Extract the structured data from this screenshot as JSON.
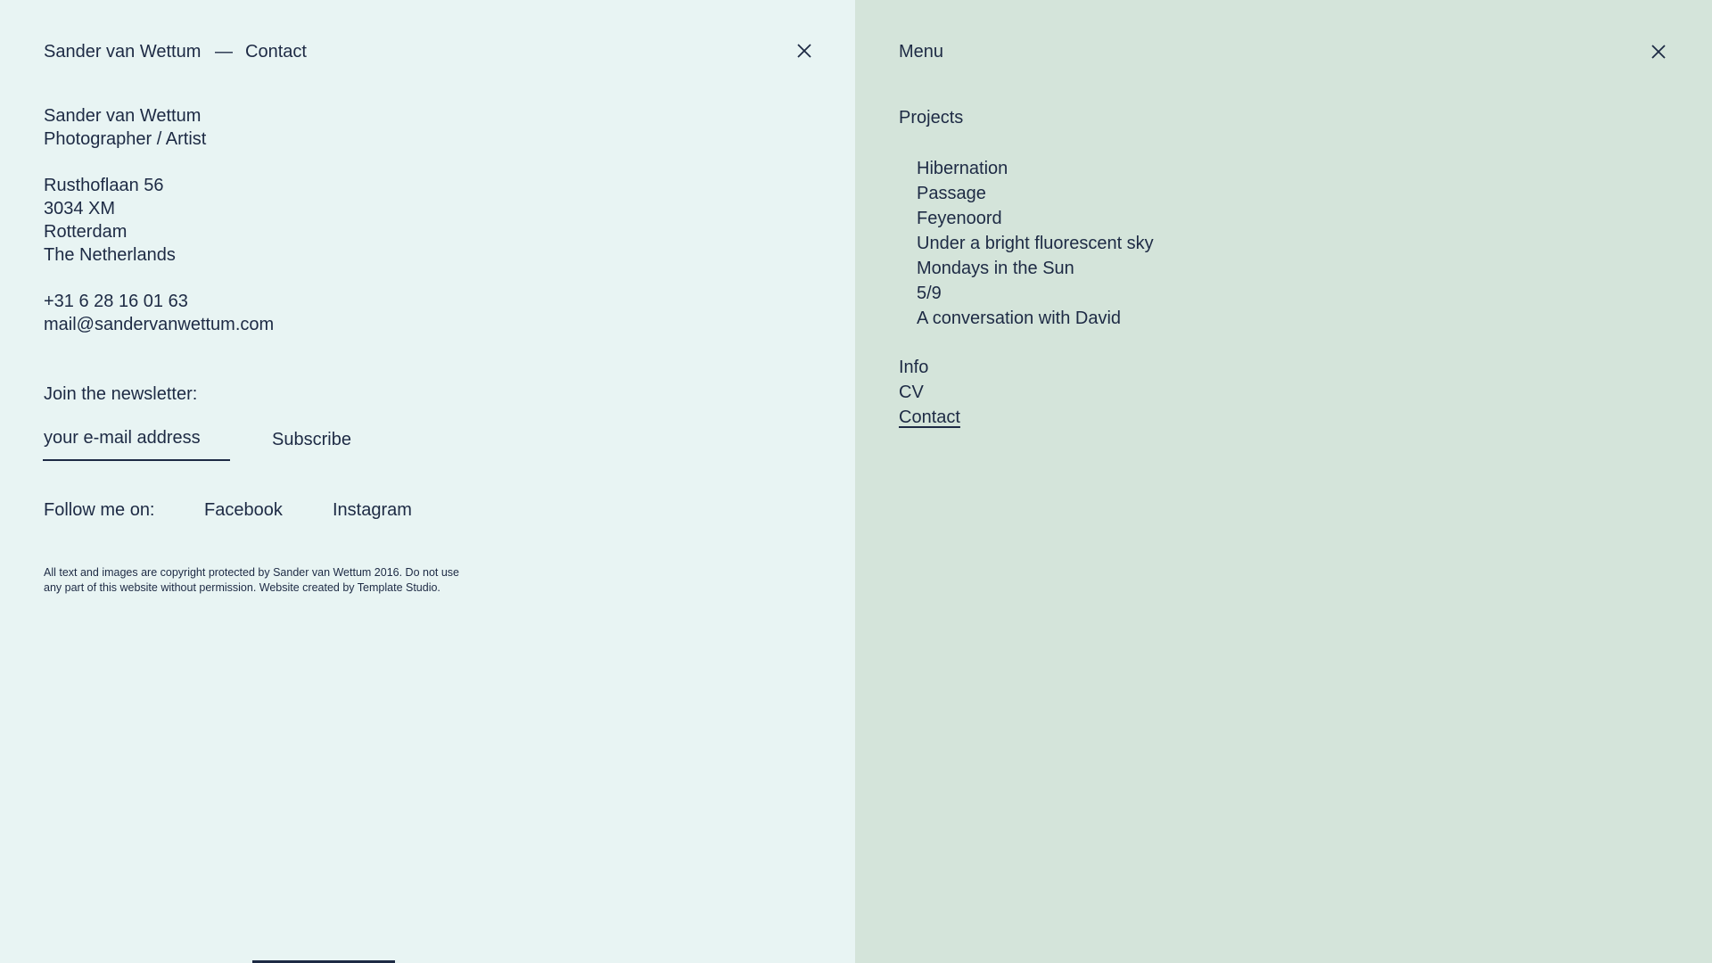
{
  "contact_panel": {
    "header": {
      "site_name": "Sander van Wettum",
      "separator": "—",
      "page_name": "Contact"
    },
    "identity": {
      "name": "Sander van Wettum",
      "role": "Photographer / Artist"
    },
    "address": {
      "street": "Rusthoflaan 56",
      "postcode": "3034 XM",
      "city": "Rotterdam",
      "country": "The Netherlands"
    },
    "contact": {
      "phone": "+31 6 28 16 01 63",
      "email": "mail@sandervanwettum.com"
    },
    "newsletter": {
      "label": "Join the newsletter:",
      "input_placeholder": "your e-mail address",
      "input_value": "",
      "subscribe_label": "Subscribe"
    },
    "social": {
      "label": "Follow me on:",
      "facebook": "Facebook",
      "instagram": "Instagram"
    },
    "copyright": {
      "line1": "All text and images are copyright protected by Sander van Wettum 2016.  Do not use",
      "line2": "any part of this website without permission. Website created by Template Studio."
    }
  },
  "menu_panel": {
    "title": "Menu",
    "projects_label": "Projects",
    "projects": [
      "Hibernation",
      "Passage",
      "Feyenoord",
      "Under a bright fluorescent sky",
      "Mondays in the Sun",
      "5/9",
      "A conversation with David"
    ],
    "links": {
      "info": "Info",
      "cv": "CV",
      "contact": "Contact"
    },
    "active_link": "Contact"
  },
  "colors": {
    "text": "#1d2a44",
    "left_background": "#e8f4f3",
    "right_background": "#d4e4da"
  },
  "icons": [
    "close-icon"
  ]
}
